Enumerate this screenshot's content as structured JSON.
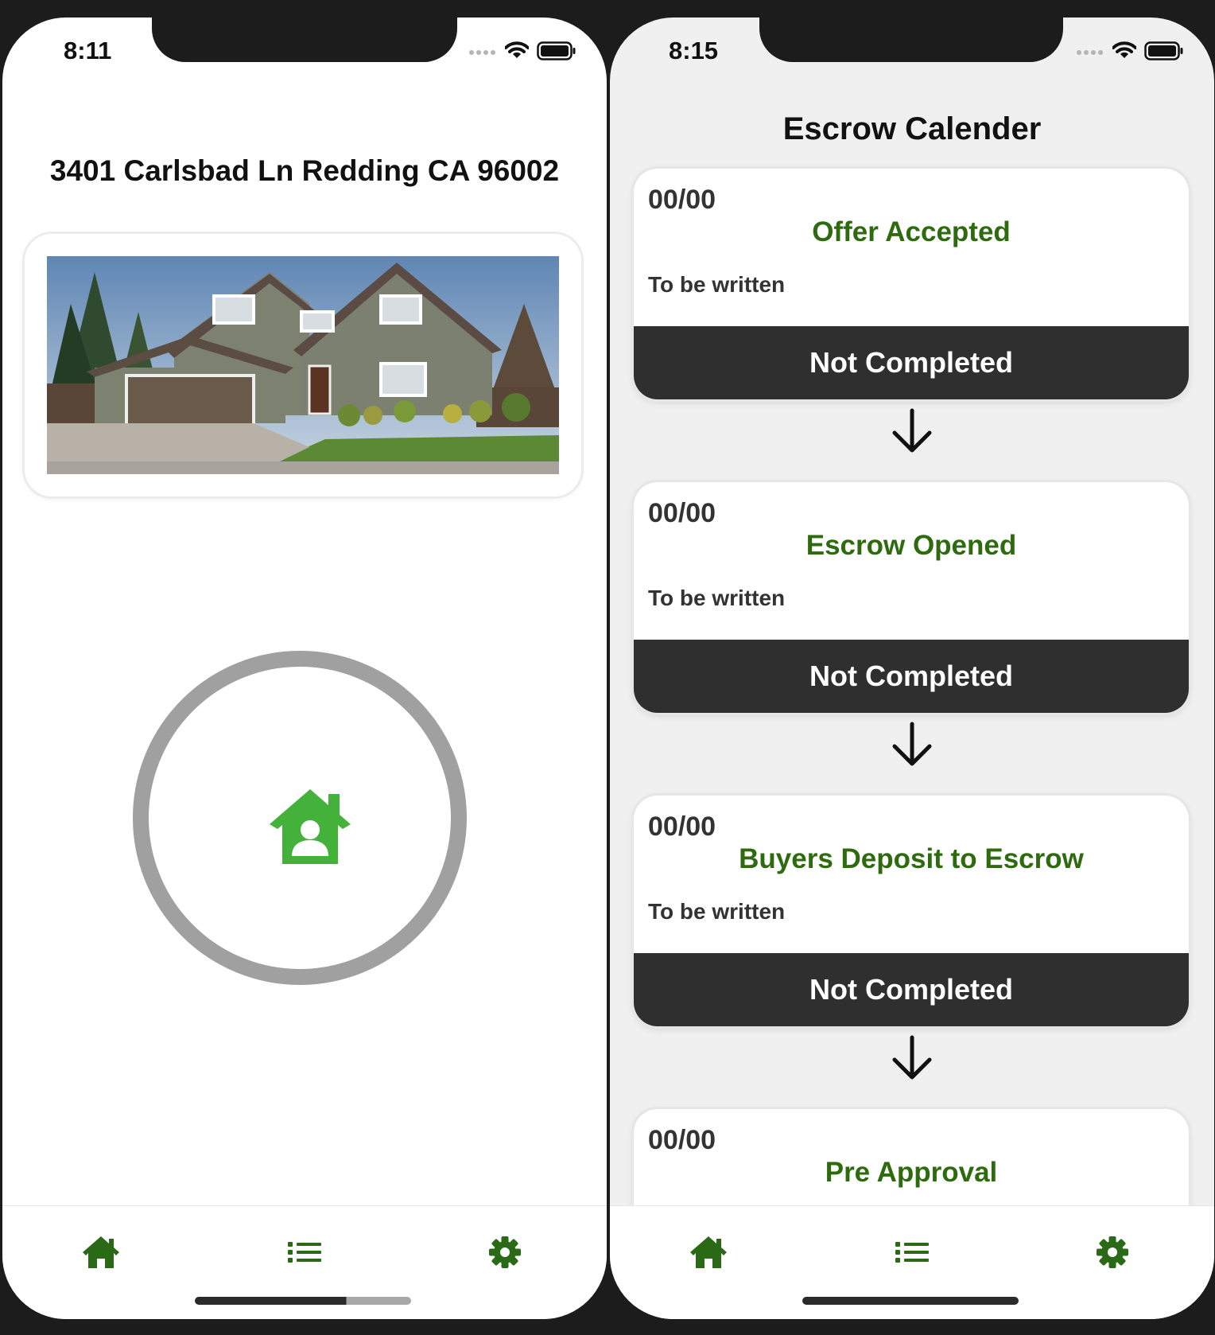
{
  "left_screen": {
    "status_time": "8:11",
    "address": "3401 Carlsbad Ln Redding CA 96002",
    "photo_icon": "house-photo",
    "center_icon": "home-user-icon",
    "accent_color": "#44b23a"
  },
  "right_screen": {
    "status_time": "8:15",
    "title": "Escrow Calender",
    "steps": [
      {
        "date": "00/00",
        "name": "Offer Accepted",
        "note": "To be written",
        "status": "Not Completed"
      },
      {
        "date": "00/00",
        "name": "Escrow Opened",
        "note": "To be written",
        "status": "Not Completed"
      },
      {
        "date": "00/00",
        "name": "Buyers Deposit to Escrow",
        "note": "To be written",
        "status": "Not Completed"
      },
      {
        "date": "00/00",
        "name": "Pre Approval"
      }
    ],
    "step_name_color": "#2e6b0f"
  },
  "tab_bar": {
    "items": [
      {
        "icon": "home-icon"
      },
      {
        "icon": "list-icon"
      },
      {
        "icon": "gear-icon"
      }
    ],
    "icon_color": "#2a6a16"
  }
}
